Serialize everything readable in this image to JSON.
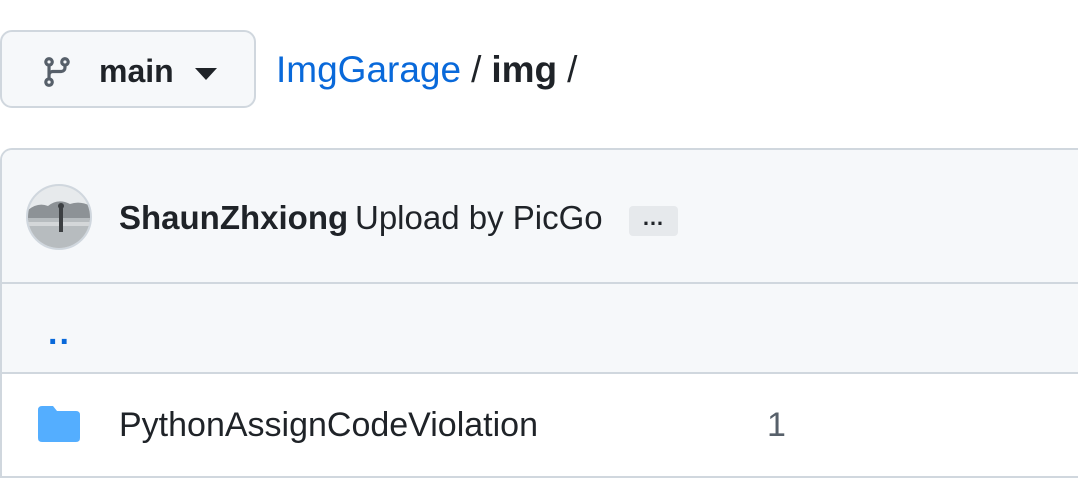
{
  "branch": {
    "name": "main"
  },
  "breadcrumb": {
    "repo": "ImgGarage",
    "separator": "/",
    "folder": "img",
    "trailing": "/"
  },
  "commit": {
    "author": "ShaunZhxiong",
    "message": "Upload by PicGo",
    "more_label": "…"
  },
  "parent_dir": {
    "label": ".."
  },
  "files": [
    {
      "type": "folder",
      "icon": "folder-icon",
      "name": "PythonAssignCodeViolation",
      "last_commit": "1"
    }
  ],
  "colors": {
    "link": "#0969da",
    "folder": "#54aeff",
    "text": "#1f2328",
    "border": "#d0d7de",
    "header_bg": "#f6f8fa"
  }
}
